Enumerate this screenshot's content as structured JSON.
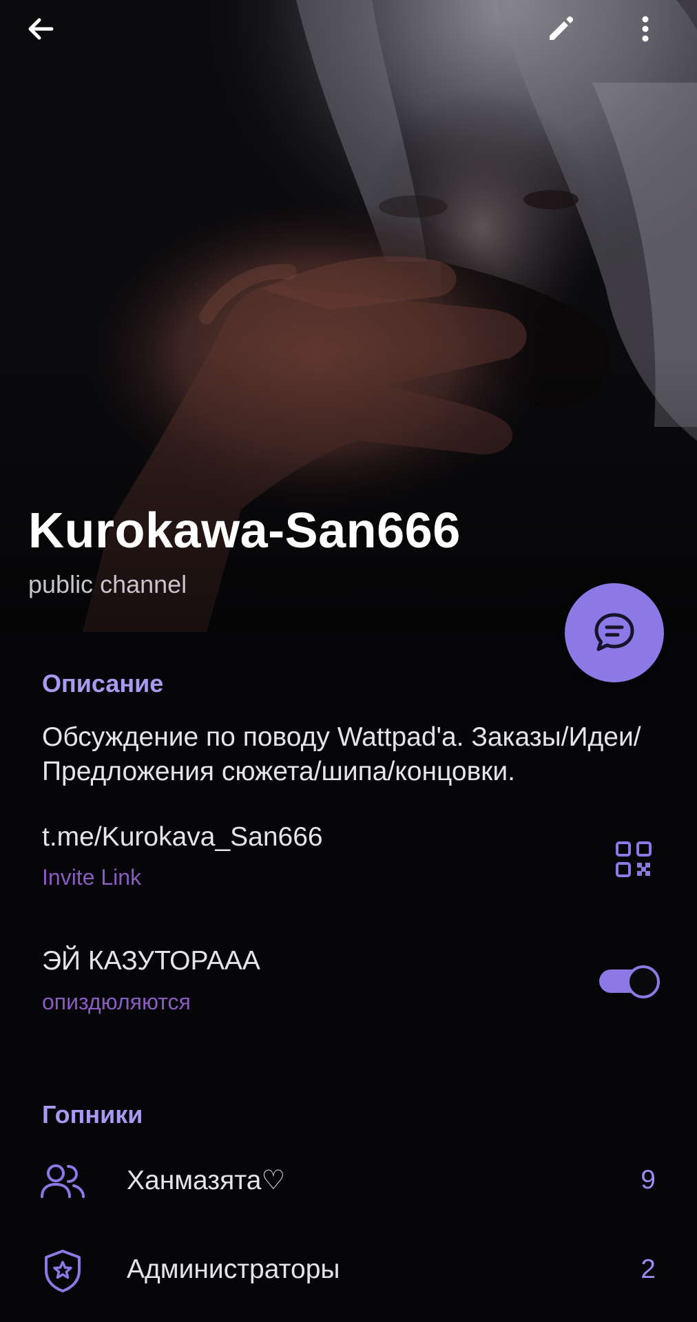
{
  "header": {
    "title": "Kurokawa-San666",
    "subtitle": "public channel"
  },
  "description": {
    "section_label": "Описание",
    "text": "Обсуждение по поводу Wattpad'a. Заказы/Идеи/Предложения сюжета/шипа/концовки."
  },
  "invite": {
    "link": "t.me/Kurokava_San666",
    "label": "Invite Link"
  },
  "setting": {
    "label": "ЭЙ КАЗУТОРААА",
    "sublabel": "опиздюляются",
    "enabled": true
  },
  "members_section": {
    "section_label": "Гопники",
    "items": [
      {
        "label": "Ханмазята♡",
        "count": "9",
        "icon": "members-icon"
      },
      {
        "label": "Администраторы",
        "count": "2",
        "icon": "admin-shield-icon"
      }
    ]
  },
  "colors": {
    "accent": "#8d79e6",
    "section_header": "#a89af0",
    "sublabel": "#8a5cc0",
    "background": "#060508"
  }
}
